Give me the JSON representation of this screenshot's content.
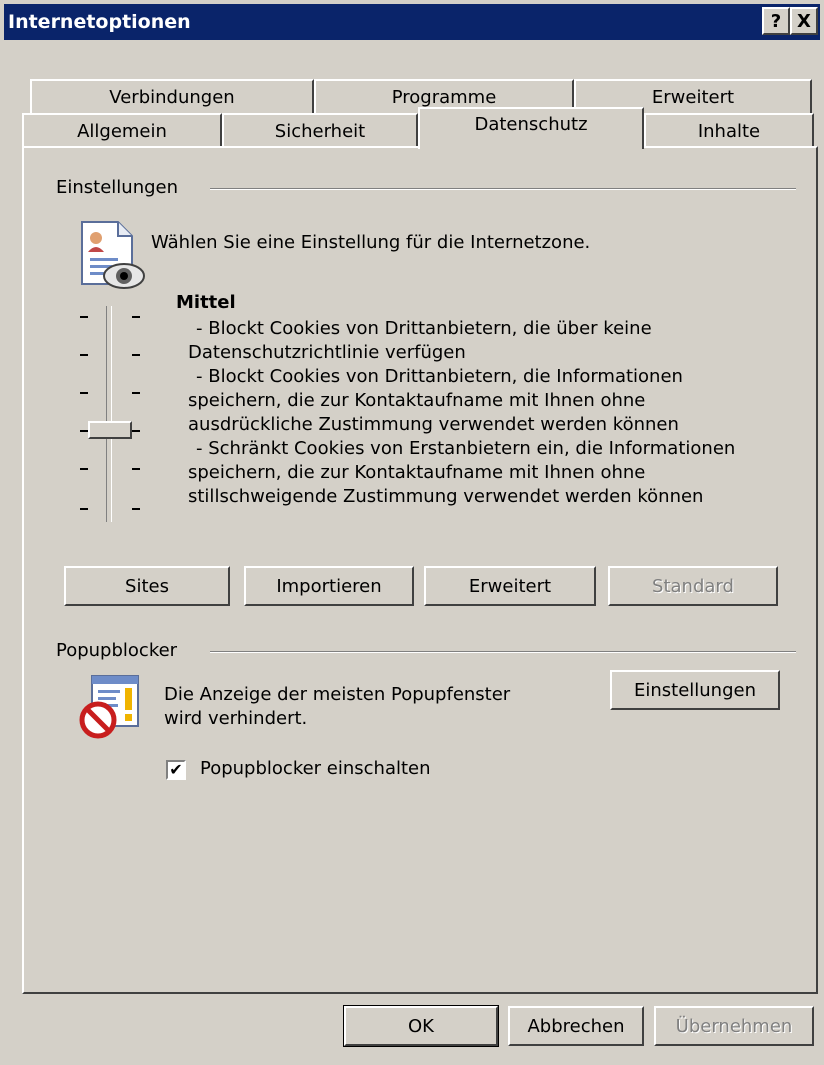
{
  "window": {
    "title": "Internetoptionen",
    "help_label": "?",
    "close_label": "X"
  },
  "tabs": {
    "row1": [
      "Verbindungen",
      "Programme",
      "Erweitert"
    ],
    "row2": [
      "Allgemein",
      "Sicherheit",
      "Datenschutz",
      "Inhalte"
    ],
    "active": "Datenschutz"
  },
  "settings": {
    "group_label": "Einstellungen",
    "description": "Wählen Sie eine Einstellung für die Internetzone.",
    "slider_level": "Mittel",
    "slider_position_of_6": 4,
    "level_lines": [
      "- Blockt Cookies von Drittanbietern, die über keine",
      "Datenschutzrichtlinie verfügen",
      "- Blockt Cookies von Drittanbietern, die Informationen",
      "speichern, die zur Kontaktaufname mit Ihnen ohne",
      "ausdrückliche Zustimmung verwendet werden können",
      "- Schränkt Cookies von Erstanbietern ein, die Informationen",
      "speichern, die zur Kontaktaufname mit Ihnen ohne",
      "stillschweigende Zustimmung verwendet werden können"
    ],
    "buttons": {
      "sites": "Sites",
      "import": "Importieren",
      "advanced": "Erweitert",
      "default": "Standard"
    }
  },
  "popup": {
    "group_label": "Popupblocker",
    "description_line1": "Die Anzeige der meisten Popupfenster",
    "description_line2": "wird verhindert.",
    "settings_button": "Einstellungen",
    "checkbox_label": "Popupblocker einschalten",
    "checkbox_checked": true,
    "check_mark": "✔"
  },
  "footer": {
    "ok": "OK",
    "cancel": "Abbrechen",
    "apply": "Übernehmen"
  }
}
